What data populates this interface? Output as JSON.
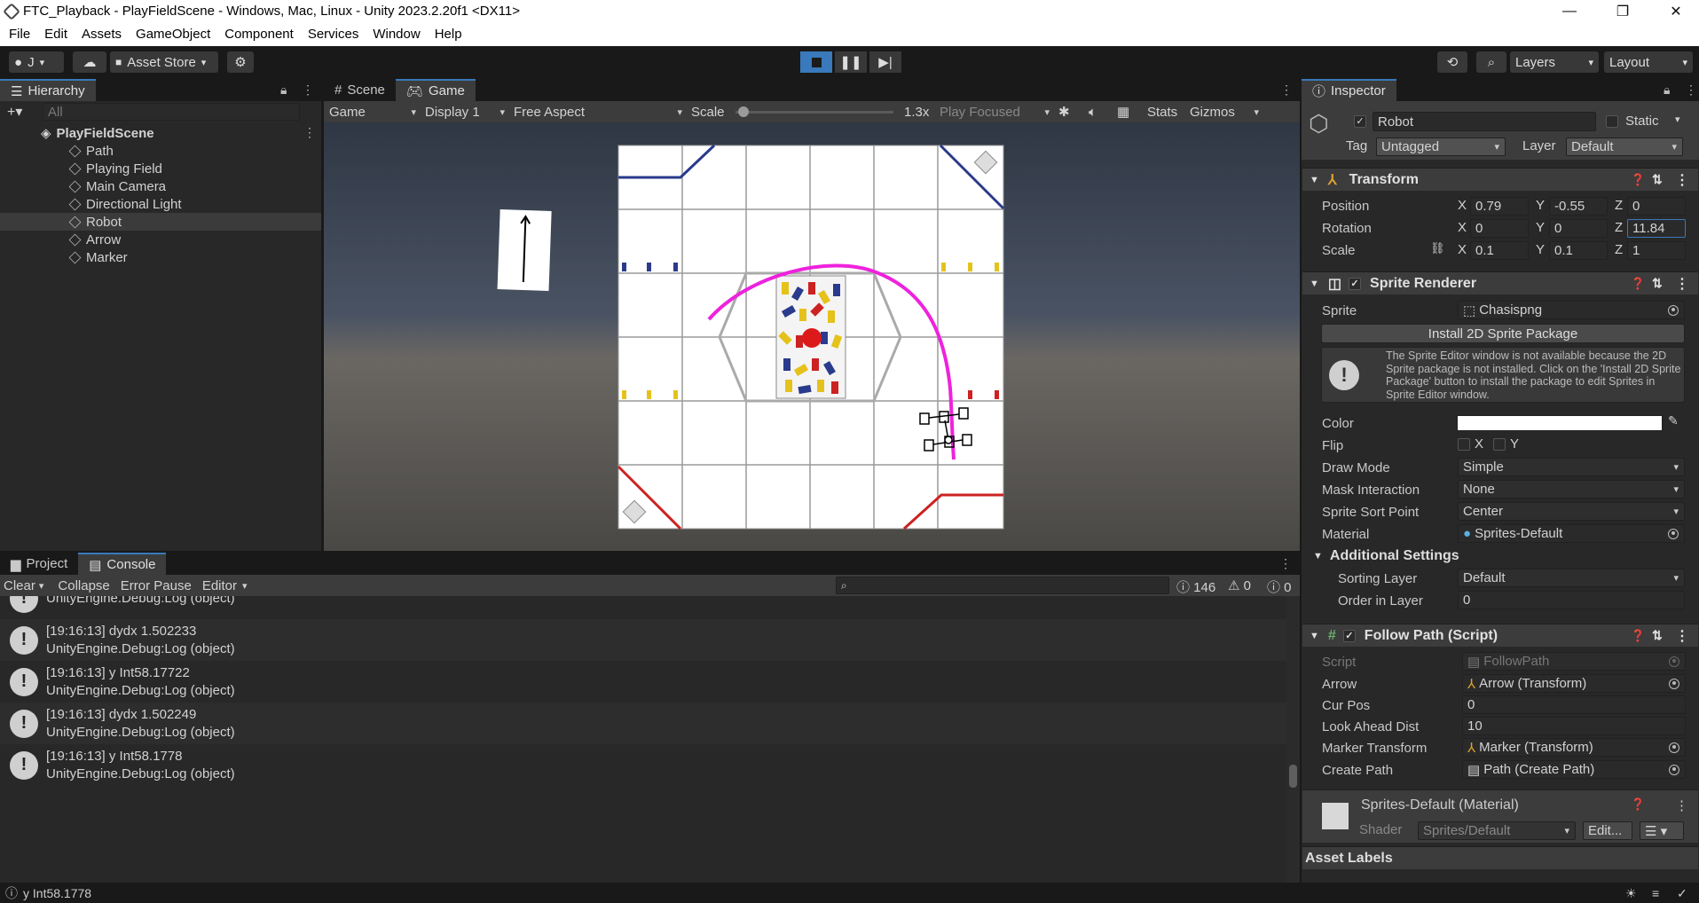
{
  "window": {
    "title": "FTC_Playback - PlayFieldScene - Windows, Mac, Linux - Unity 2023.2.20f1 <DX11>",
    "minimize": "—",
    "maximize": "❐",
    "close": "✕"
  },
  "menu": [
    "File",
    "Edit",
    "Assets",
    "GameObject",
    "Component",
    "Services",
    "Window",
    "Help"
  ],
  "toolbar": {
    "account": "J",
    "asset_store": "Asset Store",
    "layers": "Layers",
    "layout": "Layout"
  },
  "hierarchy": {
    "tab": "Hierarchy",
    "search_placeholder": "All",
    "scene": "PlayFieldScene",
    "items": [
      "Path",
      "Playing Field",
      "Main Camera",
      "Directional Light",
      "Robot",
      "Arrow",
      "Marker"
    ],
    "selected": "Robot"
  },
  "game": {
    "tabs": [
      "Scene",
      "Game"
    ],
    "active_tab": "Game",
    "mode": "Game",
    "display": "Display 1",
    "aspect": "Free Aspect",
    "scale_label": "Scale",
    "scale_value": "1.3x",
    "scale_fraction": 0.02,
    "play_focused": "Play Focused",
    "stats": "Stats",
    "gizmos": "Gizmos"
  },
  "console": {
    "tabs": [
      "Project",
      "Console"
    ],
    "active_tab": "Console",
    "clear": "Clear",
    "collapse": "Collapse",
    "error_pause": "Error Pause",
    "editor": "Editor",
    "counts": {
      "log": "146",
      "warn": "0",
      "error": "0"
    },
    "rows": [
      {
        "line1": "",
        "line2": "UnityEngine.Debug:Log (object)"
      },
      {
        "line1": "[19:16:13] dydx 1.502233",
        "line2": "UnityEngine.Debug:Log (object)"
      },
      {
        "line1": "[19:16:13] y Int58.17722",
        "line2": "UnityEngine.Debug:Log (object)"
      },
      {
        "line1": "[19:16:13] dydx 1.502249",
        "line2": "UnityEngine.Debug:Log (object)"
      },
      {
        "line1": "[19:16:13] y Int58.1778",
        "line2": "UnityEngine.Debug:Log (object)"
      }
    ]
  },
  "inspector": {
    "tab": "Inspector",
    "object_name": "Robot",
    "static": "Static",
    "tag_label": "Tag",
    "tag": "Untagged",
    "layer_label": "Layer",
    "layer": "Default",
    "transform": {
      "title": "Transform",
      "position_label": "Position",
      "rotation_label": "Rotation",
      "scale_label": "Scale",
      "px": "0.79",
      "py": "-0.55",
      "pz": "0",
      "rx": "0",
      "ry": "0",
      "rz": "11.84",
      "sx": "0.1",
      "sy": "0.1",
      "sz": "1"
    },
    "sprite_renderer": {
      "title": "Sprite Renderer",
      "sprite_label": "Sprite",
      "sprite": "Chasispng",
      "install_button": "Install 2D Sprite Package",
      "help": "The Sprite Editor window is not available because the 2D Sprite package is not installed. Click on the 'Install 2D Sprite Package' button to install the package to edit Sprites in Sprite Editor window.",
      "color_label": "Color",
      "flip_label": "Flip",
      "flip_x": "X",
      "flip_y": "Y",
      "draw_mode_label": "Draw Mode",
      "draw_mode": "Simple",
      "mask_label": "Mask Interaction",
      "mask": "None",
      "sort_point_label": "Sprite Sort Point",
      "sort_point": "Center",
      "material_label": "Material",
      "material": "Sprites-Default",
      "additional": "Additional Settings",
      "sorting_layer_label": "Sorting Layer",
      "sorting_layer": "Default",
      "order_label": "Order in Layer",
      "order": "0"
    },
    "follow_path": {
      "title": "Follow Path (Script)",
      "script_label": "Script",
      "script": "FollowPath",
      "arrow_label": "Arrow",
      "arrow": "Arrow (Transform)",
      "curpos_label": "Cur Pos",
      "curpos": "0",
      "lookahead_label": "Look Ahead Dist",
      "lookahead": "10",
      "marker_label": "Marker Transform",
      "marker": "Marker (Transform)",
      "createpath_label": "Create Path",
      "createpath": "Path (Create Path)"
    },
    "material": {
      "title": "Sprites-Default (Material)",
      "shader_label": "Shader",
      "shader": "Sprites/Default",
      "edit": "Edit..."
    },
    "asset_labels": "Asset Labels"
  },
  "status": {
    "text": "y Int58.1778"
  }
}
